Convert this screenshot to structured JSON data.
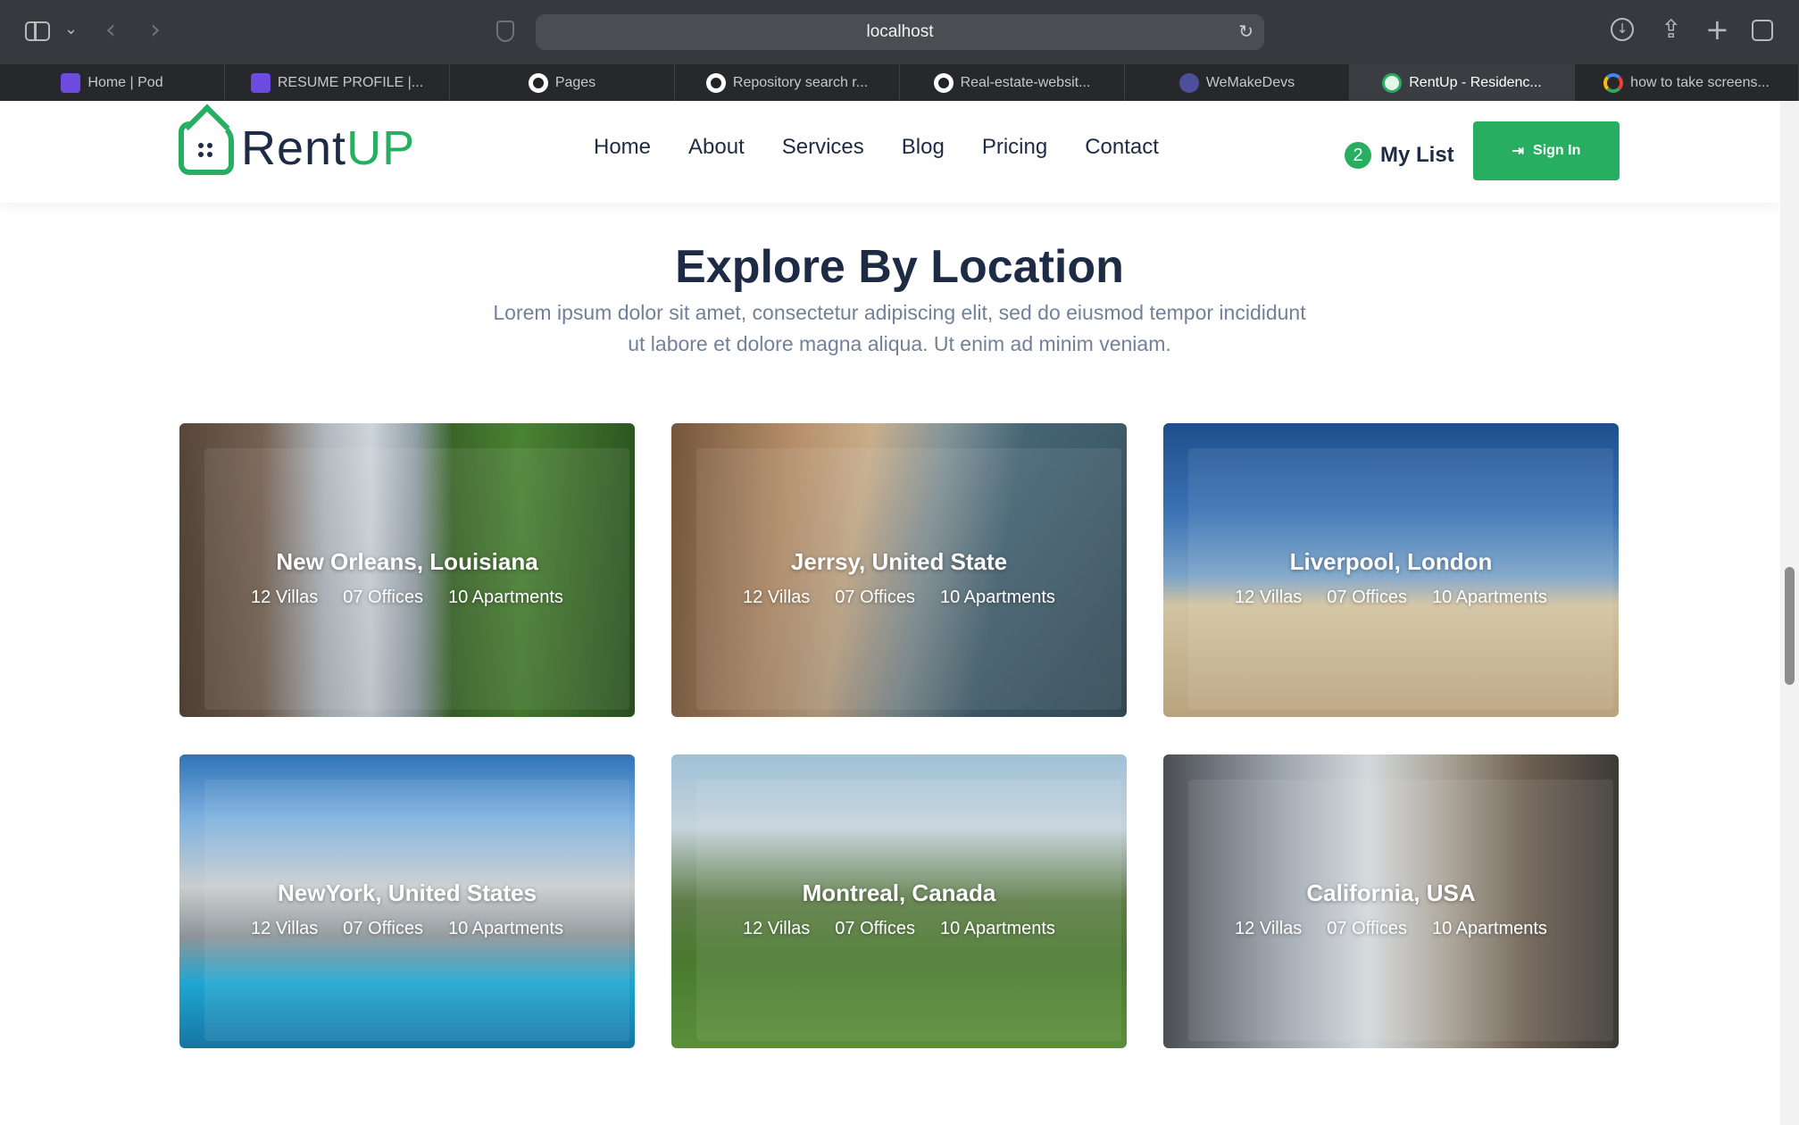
{
  "browser": {
    "url": "localhost",
    "tabs": [
      {
        "label": "Home | Pod",
        "icon": "pod-favicon"
      },
      {
        "label": "RESUME PROFILE |...",
        "icon": "pod-favicon"
      },
      {
        "label": "Pages",
        "icon": "github-icon"
      },
      {
        "label": "Repository search r...",
        "icon": "github-icon"
      },
      {
        "label": "Real-estate-websit...",
        "icon": "github-icon"
      },
      {
        "label": "WeMakeDevs",
        "icon": "wemakedevs-icon"
      },
      {
        "label": "RentUp - Residenc...",
        "icon": "rentup-icon",
        "active": true
      },
      {
        "label": "how to take screens...",
        "icon": "google-icon"
      }
    ]
  },
  "header": {
    "logo_rent": "Rent",
    "logo_up": "UP",
    "nav": [
      "Home",
      "About",
      "Services",
      "Blog",
      "Pricing",
      "Contact"
    ],
    "mylist_count": "2",
    "mylist_label": "My List",
    "signin_label": "Sign In",
    "signin_icon": "sign-in-icon"
  },
  "section": {
    "title": "Explore By Location",
    "description": "Lorem ipsum dolor sit amet, consectetur adipiscing elit, sed do eiusmod tempor incididunt ut labore et dolore magna aliqua. Ut enim ad minim veniam."
  },
  "locations": [
    {
      "name": "New Orleans, Louisiana",
      "villas": "12 Villas",
      "offices": "07 Offices",
      "apartments": "10 Apartments"
    },
    {
      "name": "Jerrsy, United State",
      "villas": "12 Villas",
      "offices": "07 Offices",
      "apartments": "10 Apartments"
    },
    {
      "name": "Liverpool, London",
      "villas": "12 Villas",
      "offices": "07 Offices",
      "apartments": "10 Apartments"
    },
    {
      "name": "NewYork, United States",
      "villas": "12 Villas",
      "offices": "07 Offices",
      "apartments": "10 Apartments"
    },
    {
      "name": "Montreal, Canada",
      "villas": "12 Villas",
      "offices": "07 Offices",
      "apartments": "10 Apartments"
    },
    {
      "name": "California, USA",
      "villas": "12 Villas",
      "offices": "07 Offices",
      "apartments": "10 Apartments"
    }
  ],
  "colors": {
    "accent": "#27ae60",
    "heading": "#1e2b44",
    "muted": "#72809a"
  }
}
